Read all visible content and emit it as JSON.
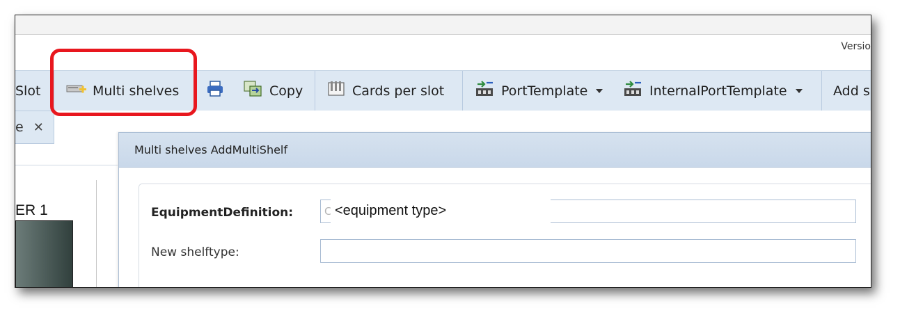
{
  "header": {
    "version_text": "Versio"
  },
  "toolbar": {
    "items": [
      {
        "label": "Slot",
        "icon": "slot-icon"
      },
      {
        "label": "Multi shelves",
        "icon": "add-shelf-icon"
      },
      {
        "label": "",
        "icon": "print-icon"
      },
      {
        "label": "Copy",
        "icon": "copy-icon"
      },
      {
        "label": "Cards per slot",
        "icon": "cards-icon"
      },
      {
        "label": "PortTemplate",
        "icon": "port-template-icon"
      },
      {
        "label": "InternalPortTemplate",
        "icon": "internal-port-template-icon"
      },
      {
        "label": "Add s",
        "icon": ""
      }
    ]
  },
  "tab": {
    "label": "e",
    "close": "✕"
  },
  "left_panel": {
    "label": "ER 1"
  },
  "dialog": {
    "title": "Multi shelves AddMultiShelf",
    "fields": [
      {
        "label": "EquipmentDefinition:",
        "value": "",
        "stub": "C",
        "overlay": "<equipment type>"
      },
      {
        "label": "New shelftype:",
        "value": ""
      }
    ]
  },
  "colors": {
    "highlight": "#e8171e",
    "toolbar_bg": "#dde8f3",
    "dialog_title_bg": "#c9d8ea"
  }
}
